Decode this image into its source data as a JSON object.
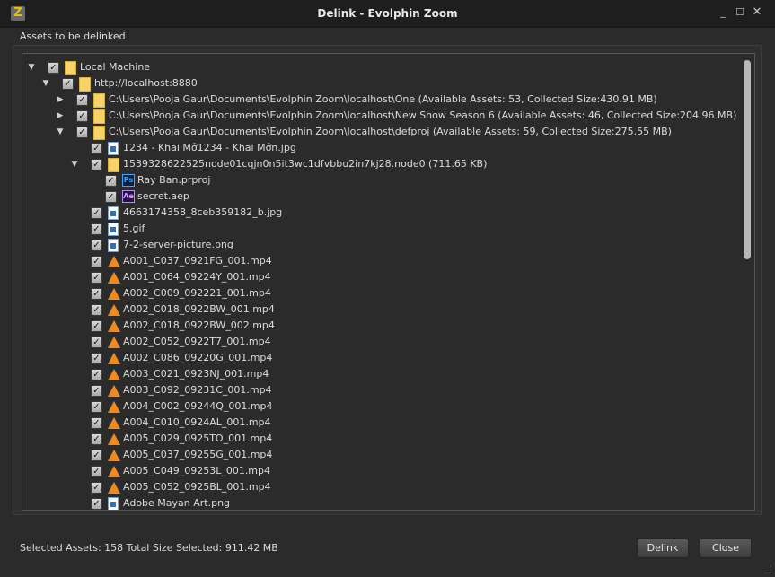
{
  "window": {
    "title": "Delink - Evolphin Zoom",
    "app_icon": "Z",
    "minimize": "_",
    "maximize": "☐",
    "close": "✕"
  },
  "section_label": "Assets to be delinked",
  "tree": [
    {
      "depth": 0,
      "arrow": "expanded",
      "checked": true,
      "icon": "folder",
      "label": "Local Machine"
    },
    {
      "depth": 1,
      "arrow": "expanded",
      "checked": true,
      "icon": "folder",
      "label": "http://localhost:8880"
    },
    {
      "depth": 2,
      "arrow": "collapsed",
      "checked": true,
      "icon": "folder",
      "label": "C:\\Users\\Pooja Gaur\\Documents\\Evolphin Zoom\\localhost\\One (Available Assets: 53, Collected Size:430.91 MB)"
    },
    {
      "depth": 2,
      "arrow": "collapsed",
      "checked": true,
      "icon": "folder",
      "label": "C:\\Users\\Pooja Gaur\\Documents\\Evolphin Zoom\\localhost\\New Show Season 6 (Available Assets: 46, Collected Size:204.96 MB)"
    },
    {
      "depth": 2,
      "arrow": "expanded",
      "checked": true,
      "icon": "folder",
      "label": "C:\\Users\\Pooja Gaur\\Documents\\Evolphin Zoom\\localhost\\defproj (Available Assets: 59, Collected Size:275.55 MB)"
    },
    {
      "depth": 3,
      "arrow": "none",
      "checked": true,
      "icon": "image",
      "label": "1234 - Khai Mở1234 - Khai Mởn.jpg"
    },
    {
      "depth": 3,
      "arrow": "expanded",
      "checked": true,
      "icon": "folder",
      "label": "1539328622525node01cqjn0n5it3wc1dfvbbu2in7kj28.node0 (711.65 KB)"
    },
    {
      "depth": 4,
      "arrow": "none",
      "checked": true,
      "icon": "ps",
      "label": "Ray Ban.prproj"
    },
    {
      "depth": 4,
      "arrow": "none",
      "checked": true,
      "icon": "ae",
      "label": "secret.aep"
    },
    {
      "depth": 3,
      "arrow": "none",
      "checked": true,
      "icon": "image",
      "label": "4663174358_8ceb359182_b.jpg"
    },
    {
      "depth": 3,
      "arrow": "none",
      "checked": true,
      "icon": "image",
      "label": "5.gif"
    },
    {
      "depth": 3,
      "arrow": "none",
      "checked": true,
      "icon": "image",
      "label": "7-2-server-picture.png"
    },
    {
      "depth": 3,
      "arrow": "none",
      "checked": true,
      "icon": "vlc",
      "label": "A001_C037_0921FG_001.mp4"
    },
    {
      "depth": 3,
      "arrow": "none",
      "checked": true,
      "icon": "vlc",
      "label": "A001_C064_09224Y_001.mp4"
    },
    {
      "depth": 3,
      "arrow": "none",
      "checked": true,
      "icon": "vlc",
      "label": "A002_C009_092221_001.mp4"
    },
    {
      "depth": 3,
      "arrow": "none",
      "checked": true,
      "icon": "vlc",
      "label": "A002_C018_0922BW_001.mp4"
    },
    {
      "depth": 3,
      "arrow": "none",
      "checked": true,
      "icon": "vlc",
      "label": "A002_C018_0922BW_002.mp4"
    },
    {
      "depth": 3,
      "arrow": "none",
      "checked": true,
      "icon": "vlc",
      "label": "A002_C052_0922T7_001.mp4"
    },
    {
      "depth": 3,
      "arrow": "none",
      "checked": true,
      "icon": "vlc",
      "label": "A002_C086_09220G_001.mp4"
    },
    {
      "depth": 3,
      "arrow": "none",
      "checked": true,
      "icon": "vlc",
      "label": "A003_C021_0923NJ_001.mp4"
    },
    {
      "depth": 3,
      "arrow": "none",
      "checked": true,
      "icon": "vlc",
      "label": "A003_C092_09231C_001.mp4"
    },
    {
      "depth": 3,
      "arrow": "none",
      "checked": true,
      "icon": "vlc",
      "label": "A004_C002_09244Q_001.mp4"
    },
    {
      "depth": 3,
      "arrow": "none",
      "checked": true,
      "icon": "vlc",
      "label": "A004_C010_0924AL_001.mp4"
    },
    {
      "depth": 3,
      "arrow": "none",
      "checked": true,
      "icon": "vlc",
      "label": "A005_C029_0925TO_001.mp4"
    },
    {
      "depth": 3,
      "arrow": "none",
      "checked": true,
      "icon": "vlc",
      "label": "A005_C037_09255G_001.mp4"
    },
    {
      "depth": 3,
      "arrow": "none",
      "checked": true,
      "icon": "vlc",
      "label": "A005_C049_09253L_001.mp4"
    },
    {
      "depth": 3,
      "arrow": "none",
      "checked": true,
      "icon": "vlc",
      "label": "A005_C052_0925BL_001.mp4"
    },
    {
      "depth": 3,
      "arrow": "none",
      "checked": true,
      "icon": "image",
      "label": "Adobe Mayan Art.png"
    }
  ],
  "footer": {
    "summary": "Selected Assets: 158  Total Size Selected: 911.42 MB"
  },
  "buttons": {
    "delink": "Delink",
    "close": "Close"
  },
  "icons": {
    "expanded": "▼",
    "collapsed": "▶",
    "check": "✓"
  }
}
